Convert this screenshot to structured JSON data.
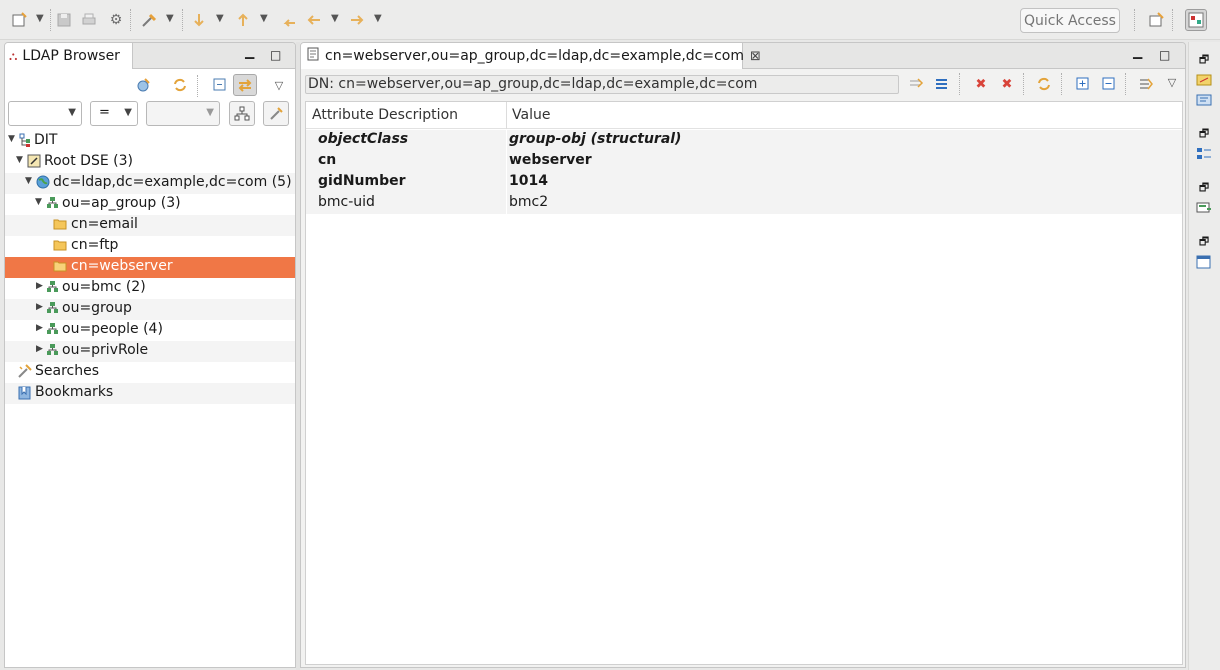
{
  "toolbar": {
    "quick_access_label": "Quick Access",
    "icons": [
      "new-wizard-icon",
      "save-icon",
      "print-icon",
      "settings-icon",
      "run-icon",
      "next-annotation-icon",
      "previous-annotation-icon",
      "last-edit-icon",
      "back-icon",
      "forward-icon",
      "open-perspective-icon",
      "ldap-perspective-icon"
    ]
  },
  "left_view": {
    "tab_title": "LDAP Browser",
    "filter": {
      "attribute_value": "",
      "operator_value": "=",
      "value_value": ""
    },
    "tree": [
      {
        "label": "DIT",
        "level": 0,
        "expanded": true,
        "icon": "dit-icon"
      },
      {
        "label": "Root DSE (3)",
        "level": 1,
        "expanded": true,
        "icon": "root-dse-icon"
      },
      {
        "label": "dc=ldap,dc=example,dc=com (5)",
        "level": 2,
        "expanded": true,
        "icon": "globe-icon"
      },
      {
        "label": "ou=ap_group (3)",
        "level": 3,
        "expanded": true,
        "icon": "ou-icon"
      },
      {
        "label": "cn=email",
        "level": 4,
        "icon": "folder-icon"
      },
      {
        "label": "cn=ftp",
        "level": 4,
        "icon": "folder-icon"
      },
      {
        "label": "cn=webserver",
        "level": 4,
        "icon": "folder-icon",
        "selected": true
      },
      {
        "label": "ou=bmc (2)",
        "level": 3,
        "expanded": false,
        "icon": "ou-icon"
      },
      {
        "label": "ou=group",
        "level": 3,
        "expanded": false,
        "icon": "ou-icon"
      },
      {
        "label": "ou=people (4)",
        "level": 3,
        "expanded": false,
        "icon": "ou-icon"
      },
      {
        "label": "ou=privRole",
        "level": 3,
        "expanded": false,
        "icon": "ou-icon"
      },
      {
        "label": "Searches",
        "level": 0,
        "icon": "searches-icon"
      },
      {
        "label": "Bookmarks",
        "level": 0,
        "icon": "bookmarks-icon"
      }
    ]
  },
  "editor": {
    "tab_title": "cn=webserver,ou=ap_group,dc=ldap,dc=example,dc=com",
    "dn_label": "DN: cn=webserver,ou=ap_group,dc=ldap,dc=example,dc=com",
    "columns": [
      "Attribute Description",
      "Value"
    ],
    "rows": [
      {
        "attribute": "objectClass",
        "value": "group-obj (structural)",
        "style": "bold-italic"
      },
      {
        "attribute": "cn",
        "value": "webserver",
        "style": "bold"
      },
      {
        "attribute": "gidNumber",
        "value": "1014",
        "style": "bold"
      },
      {
        "attribute": "bmc-uid",
        "value": "bmc2",
        "style": "normal"
      }
    ]
  },
  "colors": {
    "selection": "#f07746",
    "accent_blue": "#2f6fbf",
    "delete_red": "#d9443a",
    "refresh_orange": "#e3a33a"
  }
}
